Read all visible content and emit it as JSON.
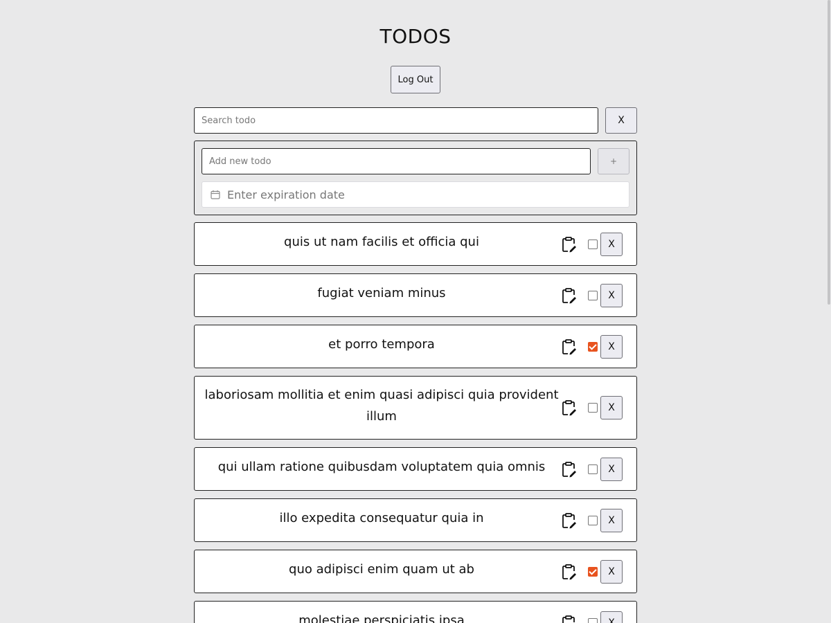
{
  "header": {
    "title": "TODOS",
    "logout_label": "Log Out"
  },
  "search": {
    "placeholder": "Search todo",
    "value": "",
    "clear_label": "X"
  },
  "add_form": {
    "placeholder": "Add new todo",
    "value": "",
    "add_label": "+",
    "date_placeholder": "Enter expiration date",
    "date_icon": "calendar-icon"
  },
  "todos": [
    {
      "text": "quis ut nam facilis et officia qui",
      "completed": false,
      "delete_label": "X"
    },
    {
      "text": "fugiat veniam minus",
      "completed": false,
      "delete_label": "X"
    },
    {
      "text": "et porro tempora",
      "completed": true,
      "delete_label": "X"
    },
    {
      "text": "laboriosam mollitia et enim quasi adipisci quia provident illum",
      "completed": false,
      "delete_label": "X"
    },
    {
      "text": "qui ullam ratione quibusdam voluptatem quia omnis",
      "completed": false,
      "delete_label": "X"
    },
    {
      "text": "illo expedita consequatur quia in",
      "completed": false,
      "delete_label": "X"
    },
    {
      "text": "quo adipisci enim quam ut ab",
      "completed": true,
      "delete_label": "X"
    },
    {
      "text": "molestiae perspiciatis ipsa",
      "completed": false,
      "delete_label": "X"
    }
  ],
  "colors": {
    "background": "#e9e9ea",
    "checkbox_checked": "#e8531f",
    "border": "#222222"
  },
  "icons": {
    "edit": "clipboard-edit-icon"
  }
}
